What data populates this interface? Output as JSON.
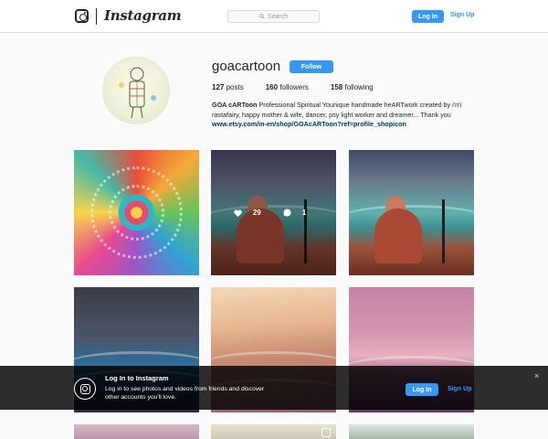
{
  "header": {
    "wordmark": "Instagram",
    "search_placeholder": "Search",
    "login_label": "Log In",
    "signup_label": "Sign Up"
  },
  "profile": {
    "username": "goacartoon",
    "follow_label": "Follow",
    "stats": [
      {
        "count": "127",
        "label": "posts"
      },
      {
        "count": "160",
        "label": "followers"
      },
      {
        "count": "158",
        "label": "following"
      }
    ],
    "bio_name": "GOA cARToon",
    "bio_text": "Professional Spiritual Younique handmade heARTwork created by i'n'i rastafairy, happy mother & wife, dancer, psy light worker and dreamer... Thank you",
    "bio_link": "www.etsy.com/in-en/shop/GOAcARToon?ref=profile_shopicon"
  },
  "hovered_post": {
    "likes": "29",
    "comments": "1"
  },
  "banner": {
    "title": "Log In to Instagram",
    "text": "Log in to see photos and videos from friends and discover other accounts you'll love.",
    "login_label": "Log In",
    "signup_label": "Sign Up",
    "close_glyph": "×"
  },
  "colors": {
    "accent": "#3897f0",
    "link": "#003569",
    "banner_bg": "#000000"
  }
}
